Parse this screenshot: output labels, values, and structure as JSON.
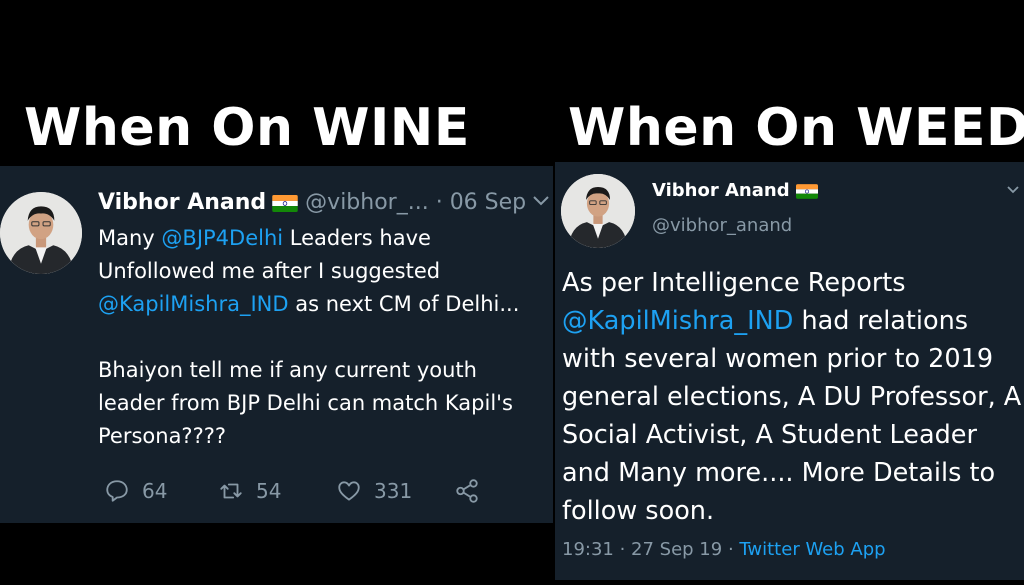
{
  "captions": {
    "left": "When On WINE",
    "right": "When On WEED"
  },
  "left_tweet": {
    "name": "Vibhor Anand",
    "handle": "@vibhor_...",
    "date": "· 06 Sep",
    "body_1a": "Many ",
    "mention_1": "@BJP4Delhi",
    "body_1b": " Leaders have Unfollowed me after I suggested ",
    "mention_2": "@KapilMishra_IND",
    "body_1c": " as next CM of Delhi...",
    "body_2": "Bhaiyon tell me if any current youth leader from BJP Delhi can match Kapil's Persona????",
    "replies": "64",
    "retweets": "54",
    "likes": "331"
  },
  "right_tweet": {
    "name": "Vibhor Anand",
    "handle": "@vibhor_anand",
    "body_a": "As per Intelligence Reports ",
    "mention": "@KapilMishra_IND",
    "body_b": " had relations with several women prior to 2019 general elections, A DU Professor, A Social Activist, A Student Leader and Many  more.... More Details to follow soon.",
    "time": "19:31 · 27 Sep 19 · ",
    "source": "Twitter Web App"
  },
  "icons": {
    "flag": "india-flag-icon",
    "menu": "chevron-down-icon",
    "reply": "reply-icon",
    "retweet": "retweet-icon",
    "like": "heart-icon",
    "share": "share-icon"
  },
  "colors": {
    "card_bg": "#15202b",
    "link": "#1da1f2",
    "muted": "#8899a6",
    "background": "#000000"
  }
}
